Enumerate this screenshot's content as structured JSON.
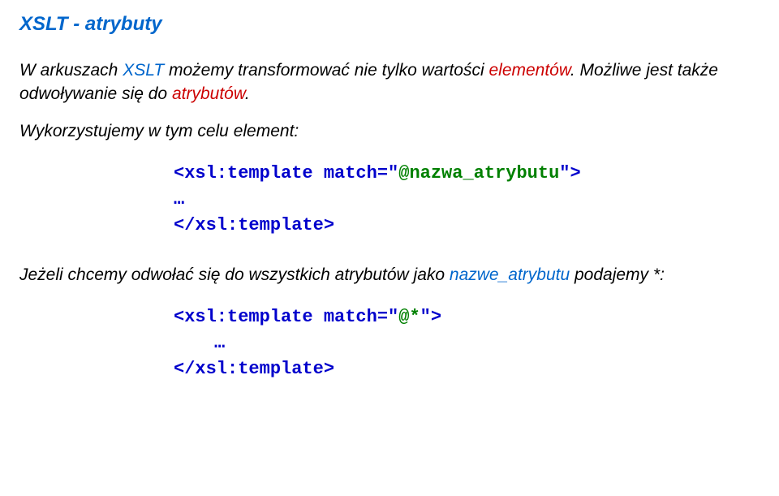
{
  "title": "XSLT - atrybuty",
  "para1_part1": "W arkuszach ",
  "para1_blue": "XSLT",
  "para1_part2": " możemy transformować nie tylko wartości ",
  "para1_red1": "elementów",
  "para1_part3": ". Możliwe jest także odwoływanie się do ",
  "para1_red2": "atrybutów",
  "para1_part4": ".",
  "para2": "Wykorzystujemy w tym celu element:",
  "code1_line1_pre": "<xsl:template match=\"",
  "code1_line1_green": "@nazwa_atrybutu",
  "code1_line1_post": "\">",
  "code1_line2": "…",
  "code1_line3": "</xsl:template>",
  "para3_part1": "Jeżeli chcemy odwołać się do wszystkich atrybutów jako ",
  "para3_blue": "nazwe_atrybutu",
  "para3_part2": " podajemy ",
  "para3_part3": "*",
  "para3_part4": ":",
  "code2_line1_pre": "<xsl:template match=\"",
  "code2_line1_green": "@*",
  "code2_line1_post": "\">",
  "code2_line2": "…",
  "code2_line3": "</xsl:template>"
}
